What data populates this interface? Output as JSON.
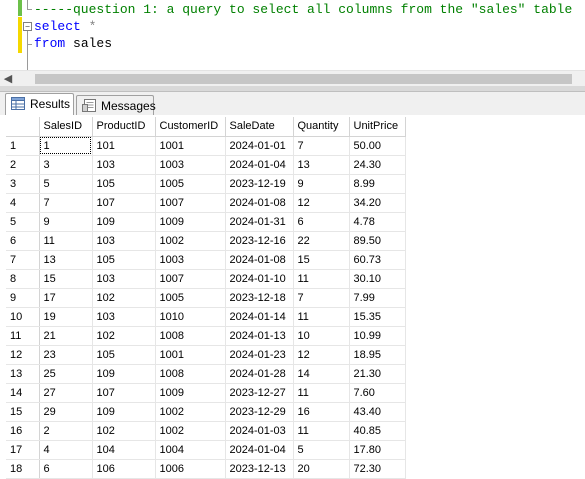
{
  "editor": {
    "lines": [
      {
        "segments": [
          {
            "cls": "comment",
            "text": "-----question 1: a query to select all columns from the \"sales\" table"
          }
        ]
      },
      {
        "segments": [
          {
            "cls": "kw",
            "text": "select"
          },
          {
            "cls": "ident",
            "text": " "
          },
          {
            "cls": "op",
            "text": "*"
          }
        ]
      },
      {
        "segments": [
          {
            "cls": "kw",
            "text": "from"
          },
          {
            "cls": "ident",
            "text": " sales"
          }
        ]
      }
    ]
  },
  "tabs": {
    "results_label": "Results",
    "messages_label": "Messages"
  },
  "grid": {
    "columns": [
      "SalesID",
      "ProductID",
      "CustomerID",
      "SaleDate",
      "Quantity",
      "UnitPrice"
    ],
    "rows": [
      [
        "1",
        "101",
        "1001",
        "2024-01-01",
        "7",
        "50.00"
      ],
      [
        "3",
        "103",
        "1003",
        "2024-01-04",
        "13",
        "24.30"
      ],
      [
        "5",
        "105",
        "1005",
        "2023-12-19",
        "9",
        "8.99"
      ],
      [
        "7",
        "107",
        "1007",
        "2024-01-08",
        "12",
        "34.20"
      ],
      [
        "9",
        "109",
        "1009",
        "2024-01-31",
        "6",
        "4.78"
      ],
      [
        "11",
        "103",
        "1002",
        "2023-12-16",
        "22",
        "89.50"
      ],
      [
        "13",
        "105",
        "1003",
        "2024-01-08",
        "15",
        "60.73"
      ],
      [
        "15",
        "103",
        "1007",
        "2024-01-10",
        "11",
        "30.10"
      ],
      [
        "17",
        "102",
        "1005",
        "2023-12-18",
        "7",
        "7.99"
      ],
      [
        "19",
        "103",
        "1010",
        "2024-01-14",
        "11",
        "15.35"
      ],
      [
        "21",
        "102",
        "1008",
        "2024-01-13",
        "10",
        "10.99"
      ],
      [
        "23",
        "105",
        "1001",
        "2024-01-23",
        "12",
        "18.95"
      ],
      [
        "25",
        "109",
        "1008",
        "2024-01-28",
        "14",
        "21.30"
      ],
      [
        "27",
        "107",
        "1009",
        "2023-12-27",
        "11",
        "7.60"
      ],
      [
        "29",
        "109",
        "1002",
        "2023-12-29",
        "16",
        "43.40"
      ],
      [
        "2",
        "102",
        "1002",
        "2024-01-03",
        "11",
        "40.85"
      ],
      [
        "4",
        "104",
        "1004",
        "2024-01-04",
        "5",
        "17.80"
      ],
      [
        "6",
        "106",
        "1006",
        "2023-12-13",
        "20",
        "72.30"
      ]
    ]
  }
}
